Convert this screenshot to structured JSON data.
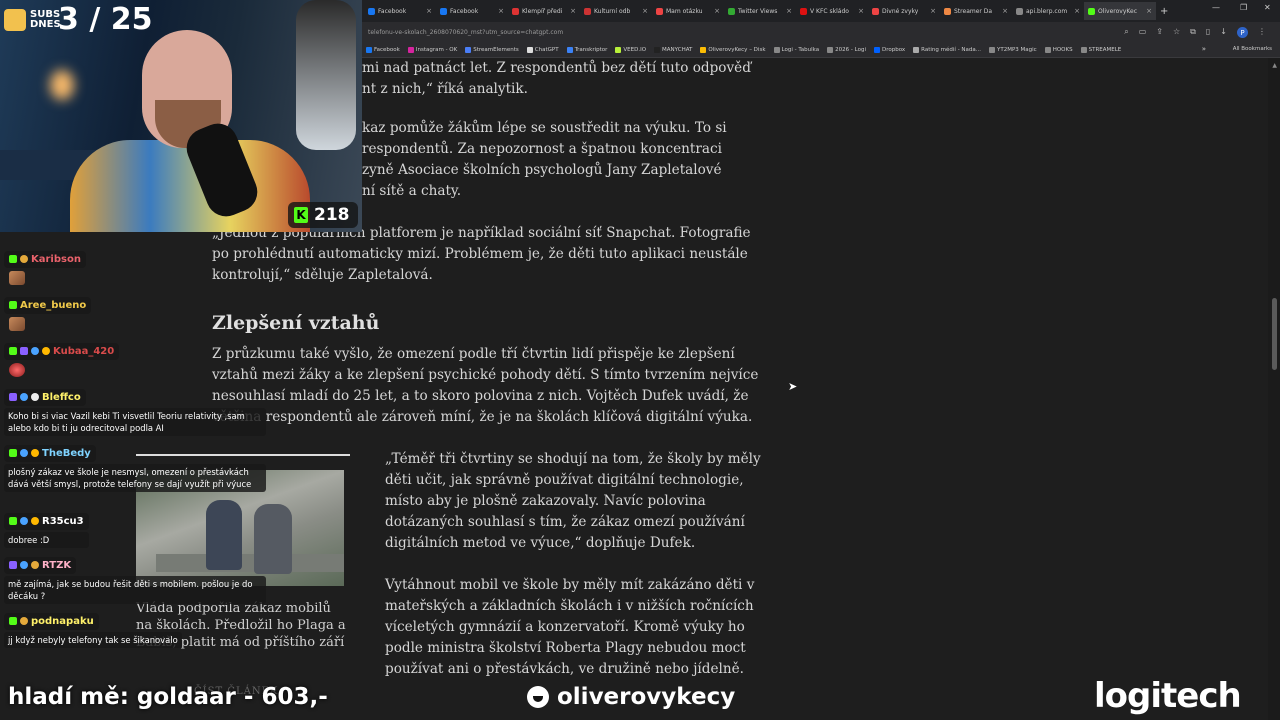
{
  "browser": {
    "tabs": [
      {
        "label": "Facebook",
        "color": "#1877f2"
      },
      {
        "label": "Facebook",
        "color": "#1877f2"
      },
      {
        "label": "Klempíř předi",
        "color": "#d33"
      },
      {
        "label": "Kulturní odb",
        "color": "#c33"
      },
      {
        "label": "Mam otázku",
        "color": "#e44"
      },
      {
        "label": "Twitter Views",
        "color": "#3a3"
      },
      {
        "label": "V KFC skládo",
        "color": "#d11"
      },
      {
        "label": "Divné zvyky",
        "color": "#e44"
      },
      {
        "label": "Streamer Da",
        "color": "#e84"
      },
      {
        "label": "api.blerp.com",
        "color": "#888"
      },
      {
        "label": "OliverovyKec",
        "color": "#53fc18"
      }
    ],
    "new_tab": "+",
    "url": "telefonu-ve-skolach_2608070620_mst?utm_source=chatgpt.com",
    "profile_initial": "P",
    "bookmarks": [
      {
        "label": "Facebook",
        "color": "#1877f2"
      },
      {
        "label": "Instagram - OK",
        "color": "#d6249f"
      },
      {
        "label": "StreamElements",
        "color": "#4a7ef7"
      },
      {
        "label": "ChatGPT",
        "color": "#ddd"
      },
      {
        "label": "Transkriptor",
        "color": "#3b82f6"
      },
      {
        "label": "VEED.IO",
        "color": "#b8f03a"
      },
      {
        "label": "MANYCHAT",
        "color": "#222"
      },
      {
        "label": "OliverovyKecy – Disk",
        "color": "#fbbc04"
      },
      {
        "label": "Logi - Tabulka",
        "color": "#888"
      },
      {
        "label": "2026 - Logi",
        "color": "#888"
      },
      {
        "label": "Dropbox",
        "color": "#0061ff"
      },
      {
        "label": "Rating médií - Nada...",
        "color": "#aaa"
      },
      {
        "label": "YT2MP3 Magic",
        "color": "#888"
      },
      {
        "label": "HOOKS",
        "color": "#888"
      },
      {
        "label": "STREAMELE",
        "color": "#888"
      }
    ],
    "all_bookmarks": "All Bookmarks"
  },
  "article": {
    "p0_line1": "mi nad patnáct let. Z respondentů bez dětí tuto odpověď",
    "p0_line2": "nt z nich,“ říká analytik.",
    "p1_line1": "kaz pomůže žákům lépe se soustředit na výuku. To si",
    "p1_line2": "respondentů. Za nepozornost a špatnou koncentraci",
    "p1_line3": "zyně Asociace školních psychologů Jany Zapletalové",
    "p1_line4": "ní sítě a chaty.",
    "p2": "„Jednou z populárních platforem je například sociální síť Snapchat. Fotografie po prohlédnutí automaticky mizí. Problémem je, že děti tuto aplikaci neustále kontrolují,“ sděluje Zapletalová.",
    "heading": "Zlepšení vztahů",
    "p3": "Z průzkumu také vyšlo, že omezení podle tří čtvrtin lidí přispěje ke zlepšení vztahů mezi žáky a ke zlepšení psychické pohody dětí. S tímto tvrzením nejvíce nesouhlasí mladí do 25 let, a to skoro polovina z nich. Vojtěch Dufek uvádí, že většina respondentů ale zároveň míní, že je na školách klíčová digitální výuka.",
    "quote": "„Téměř tři čtvrtiny se shodují na tom, že školy by měly děti učit, jak správně používat digitální technologie, místo aby je plošně zakazovaly. Navíc polovina dotázaných souhlasí s tím, že zákaz omezí používání digitálních metod ve výuce,“ doplňuje Dufek.",
    "p4": "Vytáhnout mobil ve škole by měly mít zakázáno děti v mateřských a základních školách i v nižších ročnících víceletých gymnázií a konzervatoří. Kromě výuky ho podle ministra školství Roberta Plagy nebudou moct používat ani o přestávkách, ve družině nebo jídelně.",
    "figure_caption": "Vláda podpořila zákaz mobilů na školách. Předložil ho Plaga a Babiš, platit má od příštího září",
    "read_more": "ČÍST ČLÁNEK"
  },
  "stream": {
    "subs_label": "SUBS DNES",
    "subs_count": "3 / 25",
    "kick_count": "218",
    "bottom_left": "hladí mě: goldaar - 603,-",
    "channel": "oliverovykecy",
    "sponsor": "logitech"
  },
  "chat": [
    {
      "user": "Karibson",
      "color": "#e9626b",
      "text": ""
    },
    {
      "user": "Aree_bueno",
      "color": "#f0c94a",
      "text": ""
    },
    {
      "user": "Kubaa_420",
      "color": "#d94b4b",
      "text": ""
    },
    {
      "user": "Bleffco",
      "color": "#fff16a",
      "text": "Koho bi si viac Vazil kebi Ti visvetlil Teoriu relativity ,sam alebo kdo bi ti ju odrecitoval podla AI"
    },
    {
      "user": "TheBedy",
      "color": "#7fd3ff",
      "text": "plošný zákaz ve škole je nesmysl, omezení o přestávkách dává větší smysl, protože telefony se dají využít při výuce"
    },
    {
      "user": "R35cu3",
      "color": "#ffffff",
      "text": "dobree :D"
    },
    {
      "user": "RTZK",
      "color": "#ffb2c8",
      "text": "mě zajímá, jak se budou řešit děti s mobilem. pošlou je do děcáku ?"
    },
    {
      "user": "podnapaku",
      "color": "#fff16a",
      "text": "jj když nebyly telefony tak se šikanovalo"
    }
  ]
}
